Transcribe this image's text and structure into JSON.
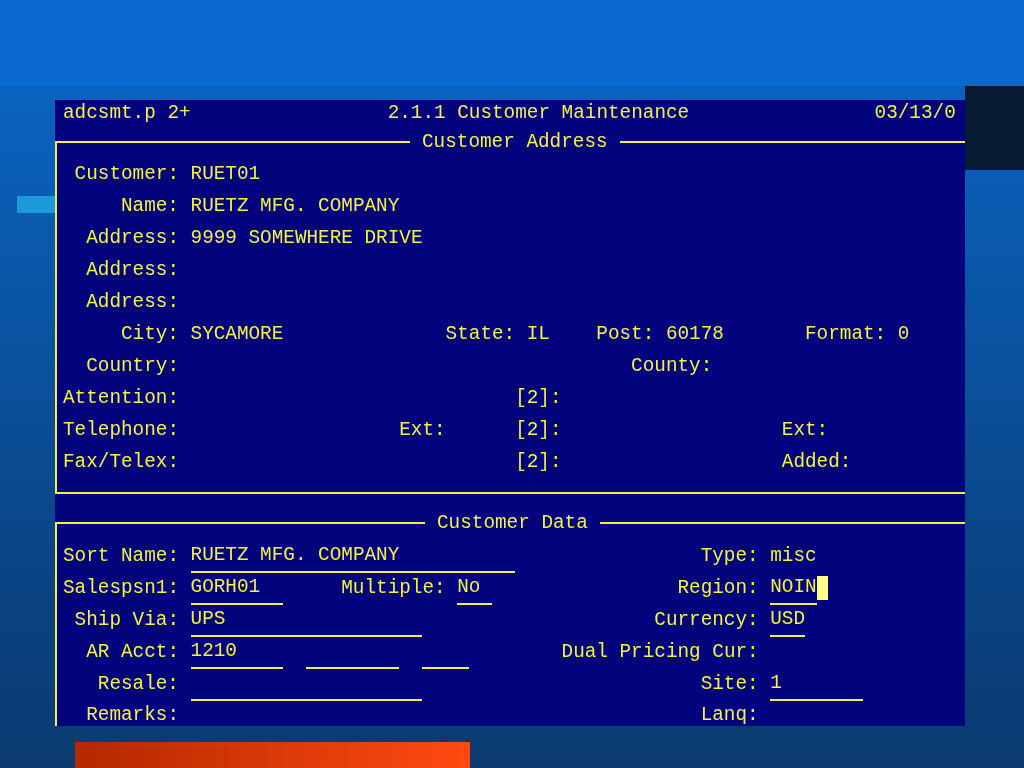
{
  "header": {
    "program": "adcsmt.p 2+",
    "title": "2.1.1 Customer Maintenance",
    "date": "03/13/0"
  },
  "sections": [
    {
      "title": "Customer Address",
      "closed": true,
      "rows": [
        {
          "items": [
            {
              "kind": "label",
              "text": "Customer:"
            },
            {
              "kind": "value",
              "text": "RUET01"
            }
          ]
        },
        {
          "items": [
            {
              "kind": "label",
              "text": "Name:"
            },
            {
              "kind": "value",
              "text": "RUETZ MFG. COMPANY"
            }
          ]
        },
        {
          "items": [
            {
              "kind": "label",
              "text": "Address:"
            },
            {
              "kind": "value",
              "text": "9999 SOMEWHERE DRIVE"
            }
          ]
        },
        {
          "items": [
            {
              "kind": "label",
              "text": "Address:"
            }
          ]
        },
        {
          "items": [
            {
              "kind": "label",
              "text": "Address:"
            }
          ]
        },
        {
          "items": [
            {
              "kind": "label",
              "text": "City:"
            },
            {
              "kind": "value",
              "text": "SYCAMORE"
            },
            {
              "kind": "label",
              "text": "State:"
            },
            {
              "kind": "value",
              "text": "IL"
            },
            {
              "kind": "label",
              "text": "Post:"
            },
            {
              "kind": "value",
              "text": "60178"
            },
            {
              "kind": "label",
              "text": "Format:"
            },
            {
              "kind": "value",
              "text": "0"
            }
          ]
        },
        {
          "items": [
            {
              "kind": "label",
              "text": "Country:"
            },
            {
              "kind": "label",
              "text": "County:"
            }
          ]
        },
        {
          "items": [
            {
              "kind": "label",
              "text": "Attention:"
            },
            {
              "kind": "label",
              "text": "[2]:"
            }
          ]
        },
        {
          "items": [
            {
              "kind": "label",
              "text": "Telephone:"
            },
            {
              "kind": "label",
              "text": "Ext:"
            },
            {
              "kind": "label",
              "text": "[2]:"
            },
            {
              "kind": "label",
              "text": "Ext:"
            }
          ]
        },
        {
          "items": [
            {
              "kind": "label",
              "text": "Fax/Telex:"
            },
            {
              "kind": "label",
              "text": "[2]:"
            },
            {
              "kind": "label",
              "text": "Added:"
            }
          ]
        }
      ]
    },
    {
      "title": "Customer Data",
      "closed": false,
      "rows": [
        {
          "items": [
            {
              "kind": "label",
              "text": "Sort Name:"
            },
            {
              "kind": "input",
              "text": "RUETZ MFG. COMPANY"
            },
            {
              "kind": "label",
              "text": "Type:"
            },
            {
              "kind": "value",
              "text": "misc"
            }
          ]
        },
        {
          "items": [
            {
              "kind": "label",
              "text": "Salespsn1:"
            },
            {
              "kind": "input",
              "text": "GORH01"
            },
            {
              "kind": "label",
              "text": "Multiple:"
            },
            {
              "kind": "input",
              "text": "No"
            },
            {
              "kind": "label",
              "text": "Region:"
            },
            {
              "kind": "input",
              "text": "NOIN",
              "cursor": true
            }
          ]
        },
        {
          "items": [
            {
              "kind": "label",
              "text": "Ship Via:"
            },
            {
              "kind": "input",
              "text": "UPS"
            },
            {
              "kind": "label",
              "text": "Currency:"
            },
            {
              "kind": "input",
              "text": "USD"
            }
          ]
        },
        {
          "items": [
            {
              "kind": "label",
              "text": "AR Acct:"
            },
            {
              "kind": "input",
              "text": "1210"
            },
            {
              "kind": "input"
            },
            {
              "kind": "input"
            },
            {
              "kind": "label",
              "text": "Dual Pricing Cur:"
            }
          ]
        },
        {
          "items": [
            {
              "kind": "label",
              "text": "Resale:"
            },
            {
              "kind": "input"
            },
            {
              "kind": "label",
              "text": "Site:"
            },
            {
              "kind": "input",
              "text": "1"
            }
          ]
        },
        {
          "items": [
            {
              "kind": "label",
              "text": "Remarks:"
            },
            {
              "kind": "label",
              "text": "Lanq:"
            }
          ]
        }
      ]
    }
  ]
}
